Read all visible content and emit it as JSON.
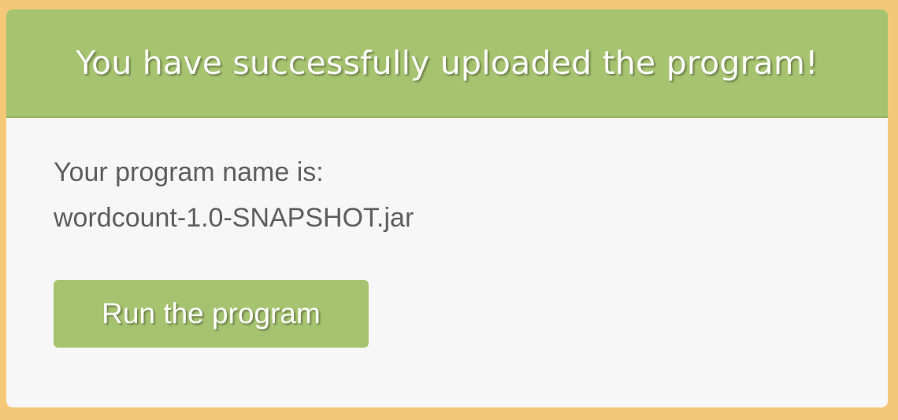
{
  "header": {
    "title": "You have successfully uploaded the program!"
  },
  "body": {
    "program_name_label": "Your program name is:",
    "program_name": "wordcount-1.0-SNAPSHOT.jar"
  },
  "actions": {
    "run_label": "Run the program"
  },
  "colors": {
    "page_background": "#f4c878",
    "accent": "#a6c46f",
    "card_background": "#f7f7f7",
    "text": "#5e5e5e"
  }
}
